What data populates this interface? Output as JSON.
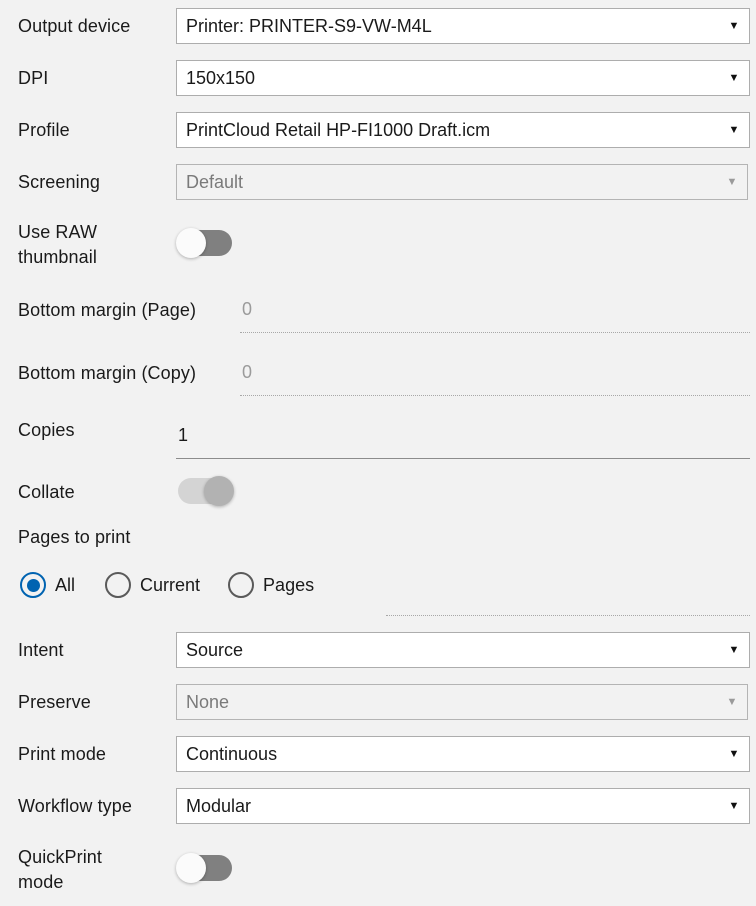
{
  "form": {
    "rows": [
      {
        "label": "Output device",
        "control": "dropdown",
        "value": "Printer: PRINTER-S9-VW-M4L",
        "enabled": true
      },
      {
        "label": "DPI",
        "control": "dropdown",
        "value": "150x150",
        "enabled": true
      },
      {
        "label": "Profile",
        "control": "dropdown",
        "value": "PrintCloud Retail HP-FI1000 Draft.icm",
        "enabled": true
      },
      {
        "label": "Screening",
        "control": "dropdown",
        "value": "Default",
        "enabled": false
      },
      {
        "label": "Use RAW\nthumbnail",
        "control": "toggle",
        "state": "off",
        "enabled": true
      },
      {
        "label": "Bottom margin (Page)",
        "control": "textfield",
        "value": "0",
        "enabled": false
      },
      {
        "label": "Bottom margin (Copy)",
        "control": "textfield",
        "value": "0",
        "enabled": false
      },
      {
        "label": "Copies",
        "control": "textfield",
        "value": "1",
        "enabled": true
      },
      {
        "label": "Collate",
        "control": "toggle",
        "state": "on",
        "enabled": false
      },
      {
        "label": "Pages to print",
        "control": "radiogroup"
      },
      {
        "label": "Intent",
        "control": "dropdown",
        "value": "Source",
        "enabled": true
      },
      {
        "label": "Preserve",
        "control": "dropdown",
        "value": "None",
        "enabled": false
      },
      {
        "label": "Print mode",
        "control": "dropdown",
        "value": "Continuous",
        "enabled": true
      },
      {
        "label": "Workflow type",
        "control": "dropdown",
        "value": "Modular",
        "enabled": true
      },
      {
        "label": "QuickPrint\nmode",
        "control": "toggle",
        "state": "off",
        "enabled": true
      }
    ],
    "pages_to_print": {
      "options": [
        {
          "label": "All",
          "checked": true
        },
        {
          "label": "Current",
          "checked": false
        },
        {
          "label": "Pages",
          "checked": false
        }
      ],
      "range_value": ""
    },
    "dropdown_arrow_glyph": "▼"
  },
  "colors": {
    "background": "#f2f2f2",
    "accent": "#0063b1",
    "text": "#1a1a1a",
    "disabled_text": "#9b9b9b",
    "border": "#adadad",
    "toggle_off_track": "#808080",
    "toggle_on_disabled_track": "#d4d4d4"
  }
}
